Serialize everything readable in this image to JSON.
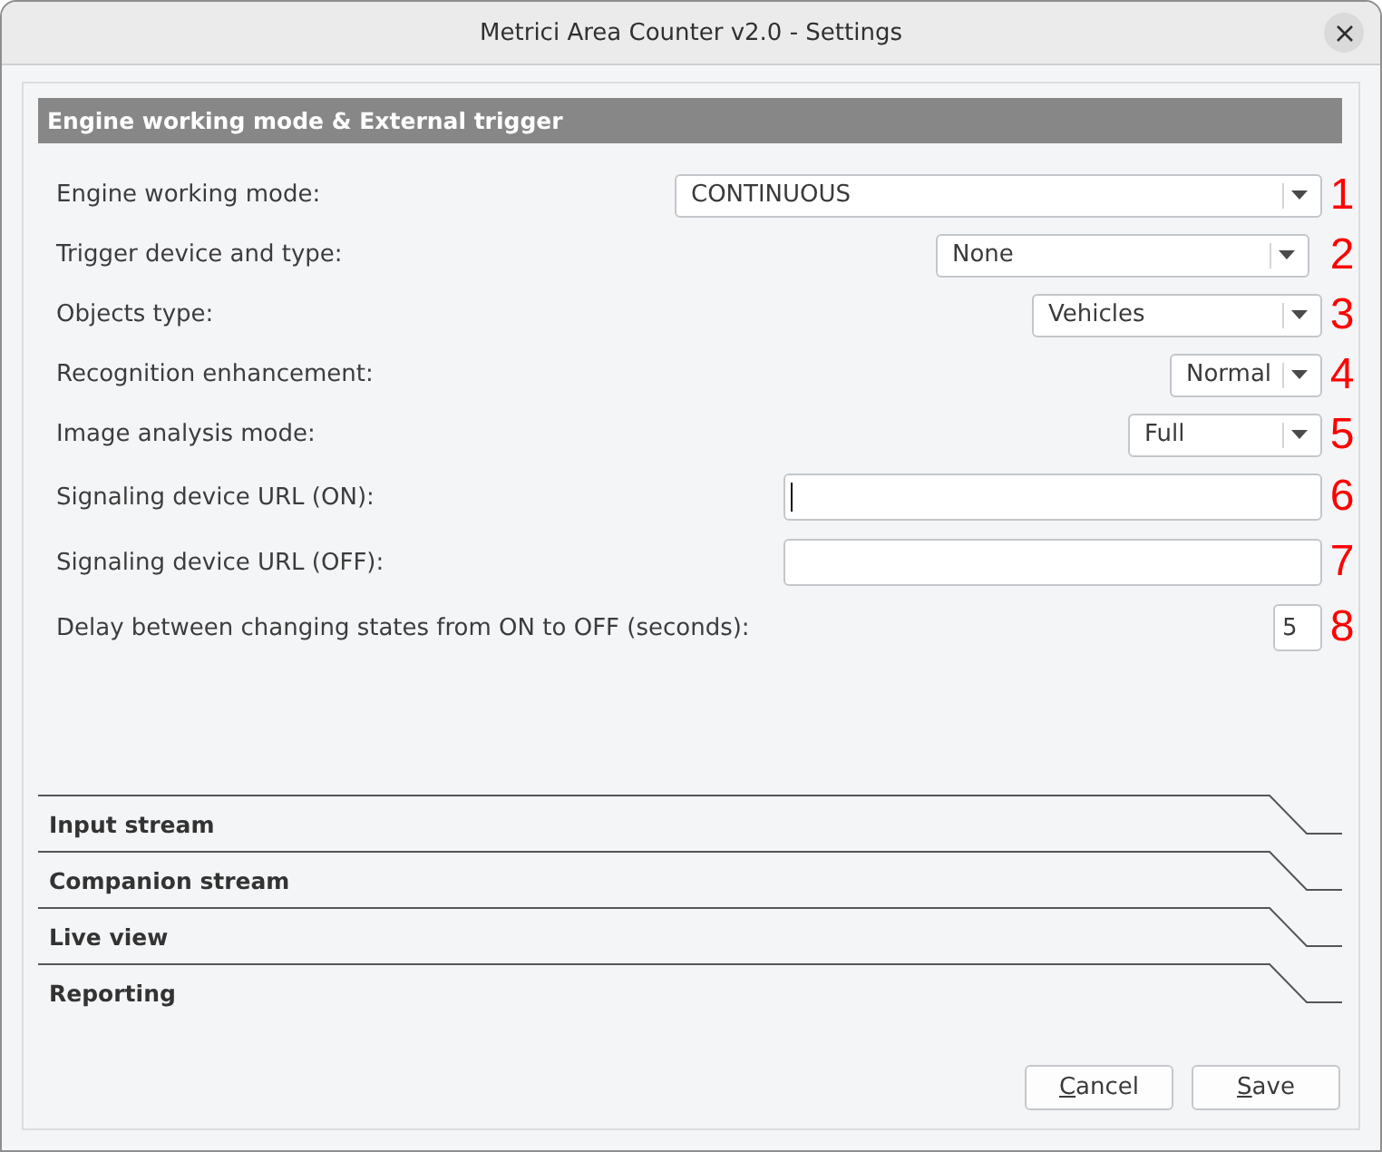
{
  "window": {
    "title": "Metrici Area Counter v2.0 - Settings"
  },
  "sections": [
    {
      "title": "Engine working mode & External trigger",
      "expanded": true,
      "fields": [
        {
          "label": "Engine working mode:",
          "kind": "dropdown",
          "value": "CONTINUOUS",
          "annotation": "1"
        },
        {
          "label": "Trigger device and type:",
          "kind": "dropdown",
          "value": "None",
          "annotation": "2"
        },
        {
          "label": "Objects type:",
          "kind": "dropdown",
          "value": "Vehicles",
          "annotation": "3"
        },
        {
          "label": "Recognition enhancement:",
          "kind": "dropdown",
          "value": "Normal",
          "annotation": "4"
        },
        {
          "label": "Image analysis mode:",
          "kind": "dropdown",
          "value": "Full",
          "annotation": "5"
        },
        {
          "label": "Signaling device URL (ON):",
          "kind": "text",
          "focused": true,
          "annotation": "6"
        },
        {
          "label": "Signaling device URL (OFF):",
          "kind": "text",
          "focused": false,
          "annotation": "7"
        },
        {
          "label": "Delay between changing states from ON to OFF (seconds):",
          "kind": "text",
          "value": "5",
          "focused": false,
          "annotation": "8"
        }
      ]
    },
    {
      "title": "Input stream",
      "expanded": false
    },
    {
      "title": "Companion stream",
      "expanded": false
    },
    {
      "title": "Live view",
      "expanded": false
    },
    {
      "title": "Reporting",
      "expanded": false
    }
  ],
  "buttons": [
    {
      "label": "Cancel",
      "mnemonic": true
    },
    {
      "label": "Save",
      "mnemonic": true
    }
  ]
}
